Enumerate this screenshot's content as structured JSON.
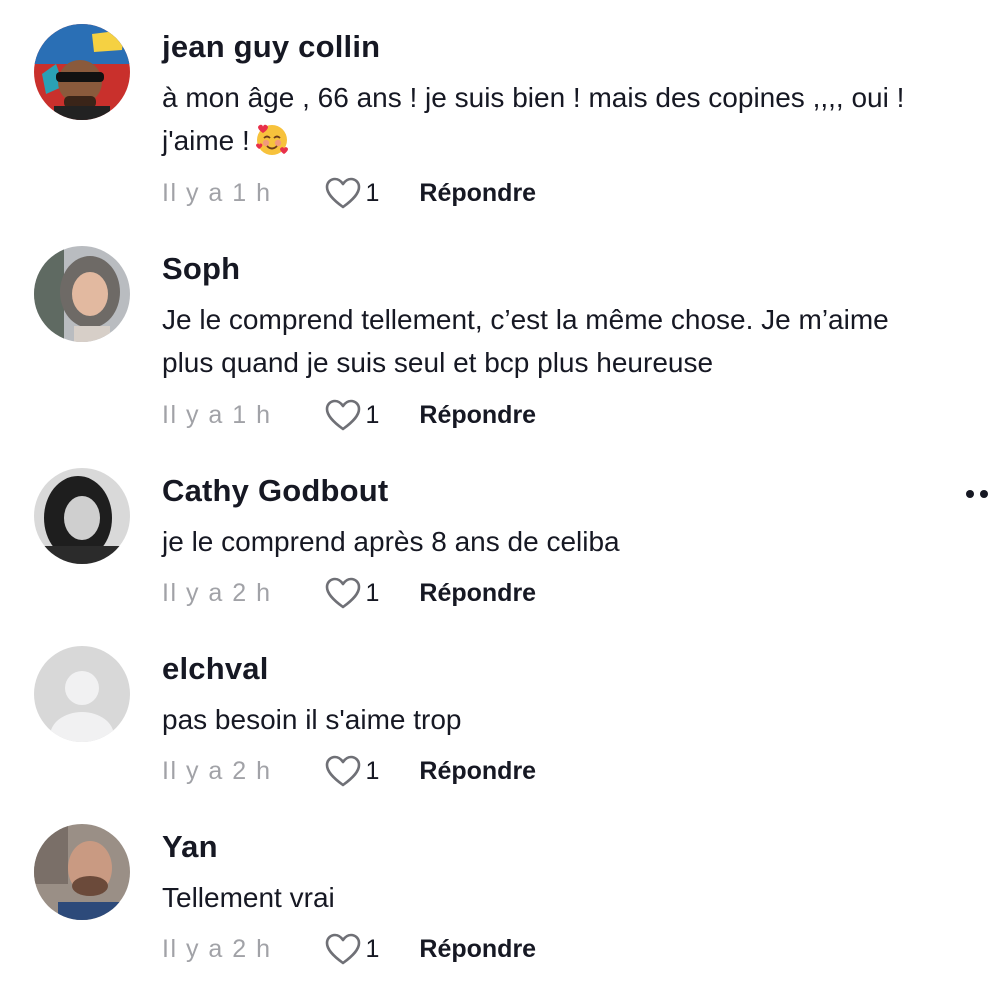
{
  "comments": [
    {
      "username": "jean guy collin",
      "text": "à mon âge , 66 ans ! je suis bien ! mais des copines ,,,, oui ! j'aime !",
      "emoji": "smiling-face-with-hearts",
      "time": "Il y a 1 h",
      "likes": "1",
      "reply": "Répondre"
    },
    {
      "username": "Soph",
      "text": "Je le comprend tellement, c’est la même chose. Je m’aime plus quand je suis seul et bcp plus heureuse",
      "time": "Il y a 1 h",
      "likes": "1",
      "reply": "Répondre"
    },
    {
      "username": "Cathy Godbout",
      "text": "je le comprend après 8 ans de celiba",
      "time": "Il y a 2 h",
      "likes": "1",
      "reply": "Répondre"
    },
    {
      "username": "elchval",
      "text": "pas besoin il s'aime trop",
      "time": "Il y a 2 h",
      "likes": "1",
      "reply": "Répondre"
    },
    {
      "username": "Yan",
      "text": "Tellement vrai",
      "time": "Il y a 2 h",
      "likes": "1",
      "reply": "Répondre"
    }
  ],
  "icons": {
    "like": "heart-outline-icon",
    "more": "more-options-icon"
  },
  "colors": {
    "text": "#161823",
    "muted": "#a1a2a7",
    "default_avatar_bg": "#d8d8d8"
  }
}
